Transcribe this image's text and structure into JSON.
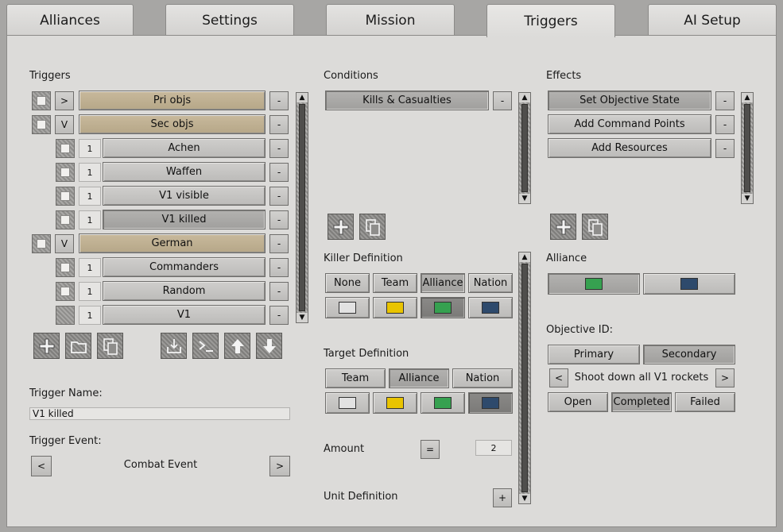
{
  "tabs": [
    {
      "label": "Alliances"
    },
    {
      "label": "Settings"
    },
    {
      "label": "Mission"
    },
    {
      "label": "Triggers"
    },
    {
      "label": "AI Setup"
    }
  ],
  "triggers": {
    "heading": "Triggers",
    "expand_closed": ">",
    "expand_open": "V",
    "minus": "-",
    "items": [
      {
        "label": "Pri objs",
        "num": ""
      },
      {
        "label": "Sec objs",
        "num": ""
      },
      {
        "label": "Achen",
        "num": "1"
      },
      {
        "label": "Waffen",
        "num": "1"
      },
      {
        "label": "V1 visible",
        "num": "1"
      },
      {
        "label": "V1 killed",
        "num": "1"
      },
      {
        "label": "German",
        "num": ""
      },
      {
        "label": "Commanders",
        "num": "1"
      },
      {
        "label": "Random",
        "num": "1"
      },
      {
        "label": "V1",
        "num": "1"
      }
    ],
    "name_label": "Trigger Name:",
    "name_value": "V1 killed",
    "event_label": "Trigger Event:",
    "event_value": "Combat Event",
    "prev": "<",
    "next": ">"
  },
  "conditions": {
    "heading": "Conditions",
    "items": [
      {
        "label": "Kills & Casualties"
      }
    ],
    "minus": "-",
    "killer_label": "Killer Definition",
    "killer_options": [
      "None",
      "Team",
      "Alliance",
      "Nation"
    ],
    "target_label": "Target Definition",
    "target_options": [
      "Team",
      "Alliance",
      "Nation"
    ],
    "amount_label": "Amount",
    "amount_op": "=",
    "amount_value": "2",
    "unit_label": "Unit Definition",
    "unit_plus": "+"
  },
  "effects": {
    "heading": "Effects",
    "minus": "-",
    "items": [
      {
        "label": "Set Objective State"
      },
      {
        "label": "Add Command Points"
      },
      {
        "label": "Add Resources"
      }
    ],
    "alliance_label": "Alliance",
    "objective_label": "Objective ID:",
    "obj_types": [
      "Primary",
      "Secondary"
    ],
    "objective_text": "Shoot down all V1 rockets",
    "prev": "<",
    "next": ">",
    "states": [
      "Open",
      "Completed",
      "Failed"
    ]
  },
  "colors": {
    "white": "#e2e2e2",
    "yellow": "#e9c400",
    "green": "#36a150",
    "navy": "#2e4a6c",
    "tan": "#bdae90"
  }
}
